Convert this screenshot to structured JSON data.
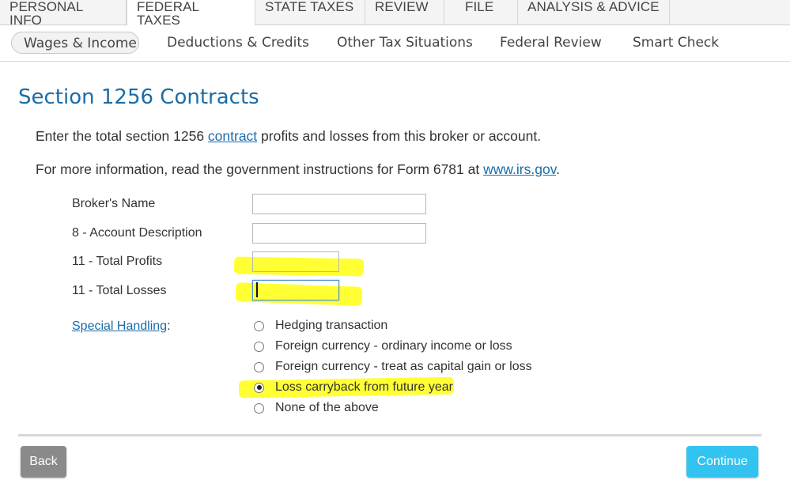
{
  "top_tabs": [
    "PERSONAL INFO",
    "FEDERAL TAXES",
    "STATE TAXES",
    "REVIEW",
    "FILE",
    "ANALYSIS & ADVICE"
  ],
  "sub_nav": [
    "Wages & Income",
    "Deductions & Credits",
    "Other Tax Situations",
    "Federal Review",
    "Smart Check"
  ],
  "title": "Section 1256 Contracts",
  "intro": {
    "before": "Enter the total section 1256 ",
    "link": "contract",
    "after": " profits and losses from this broker or account."
  },
  "info": {
    "before": "For more information, read the government instructions for Form 6781 at ",
    "link": "www.irs.gov",
    "after": "."
  },
  "fields": {
    "broker_name": {
      "label": "Broker's Name",
      "value": ""
    },
    "account_description": {
      "label": "8 - Account Description",
      "value": ""
    },
    "total_profits": {
      "label": "11 - Total Profits",
      "value": ""
    },
    "total_losses": {
      "label": "11 - Total Losses",
      "value": ""
    }
  },
  "special_handling": {
    "link": "Special Handling",
    "suffix": ":",
    "options": [
      "Hedging transaction",
      "Foreign currency - ordinary income or loss",
      "Foreign currency - treat as capital gain or loss",
      "Loss carryback from future year",
      "None of the above"
    ],
    "selected": "Loss carryback from future year"
  },
  "buttons": {
    "back": "Back",
    "continue": "Continue"
  },
  "colors": {
    "title": "#1b6ca8",
    "link": "#1b6ca8",
    "continue": "#33c3f0",
    "back": "#8a8a8a",
    "highlight": "#ffff1e"
  }
}
